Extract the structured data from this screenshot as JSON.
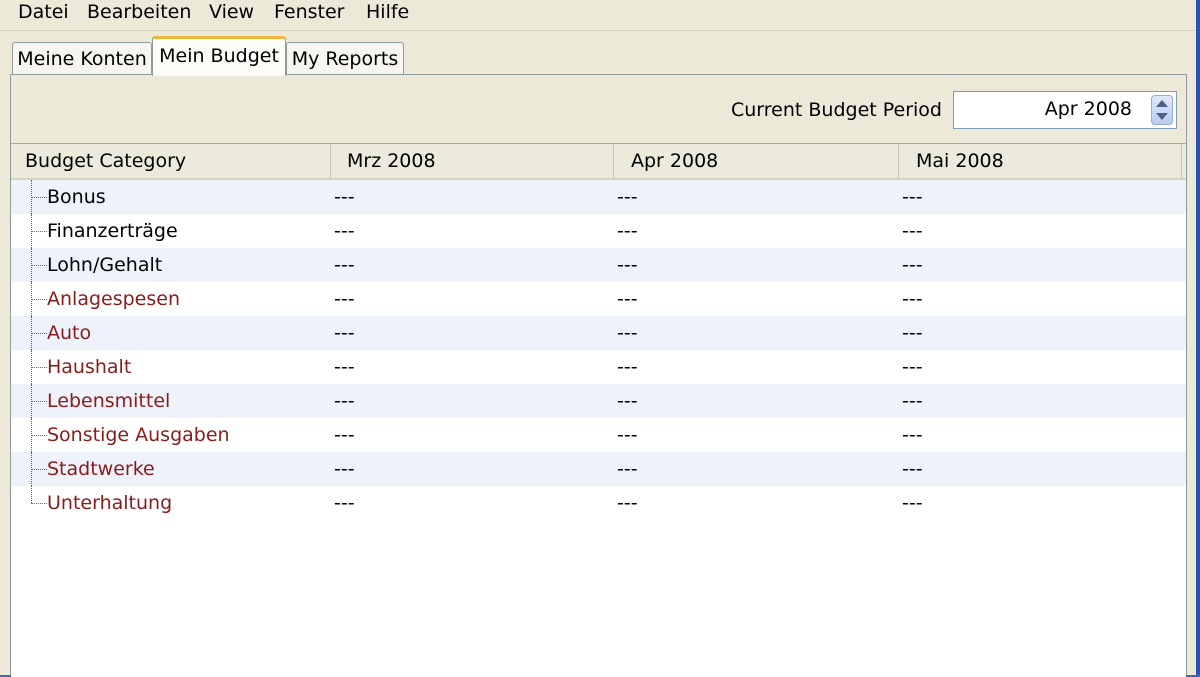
{
  "menu": {
    "items": [
      "Datei",
      "Bearbeiten",
      "View",
      "Fenster",
      "Hilfe"
    ]
  },
  "tabs": [
    {
      "label": "Meine Konten",
      "active": false
    },
    {
      "label": "Mein Budget",
      "active": true
    },
    {
      "label": "My Reports",
      "active": false
    }
  ],
  "period": {
    "label": "Current Budget Period",
    "value": "Apr 2008"
  },
  "table": {
    "columns": [
      "Budget Category",
      "Mrz 2008",
      "Apr 2008",
      "Mai 2008"
    ],
    "rows": [
      {
        "category": "Bonus",
        "type": "income",
        "values": [
          "---",
          "---",
          "---"
        ]
      },
      {
        "category": "Finanzerträge",
        "type": "income",
        "values": [
          "---",
          "---",
          "---"
        ]
      },
      {
        "category": "Lohn/Gehalt",
        "type": "income",
        "values": [
          "---",
          "---",
          "---"
        ]
      },
      {
        "category": "Anlagespesen",
        "type": "expense",
        "values": [
          "---",
          "---",
          "---"
        ]
      },
      {
        "category": "Auto",
        "type": "expense",
        "values": [
          "---",
          "---",
          "---"
        ]
      },
      {
        "category": "Haushalt",
        "type": "expense",
        "values": [
          "---",
          "---",
          "---"
        ]
      },
      {
        "category": "Lebensmittel",
        "type": "expense",
        "values": [
          "---",
          "---",
          "---"
        ]
      },
      {
        "category": "Sonstige Ausgaben",
        "type": "expense",
        "values": [
          "---",
          "---",
          "---"
        ]
      },
      {
        "category": "Stadtwerke",
        "type": "expense",
        "values": [
          "---",
          "---",
          "---"
        ]
      },
      {
        "category": "Unterhaltung",
        "type": "expense",
        "values": [
          "---",
          "---",
          "---"
        ]
      }
    ]
  },
  "colors": {
    "expense_text": "#8b1b1b",
    "income_text": "#000000",
    "active_tab_accent": "#f3b43e",
    "row_alt": "#eef2fb"
  }
}
